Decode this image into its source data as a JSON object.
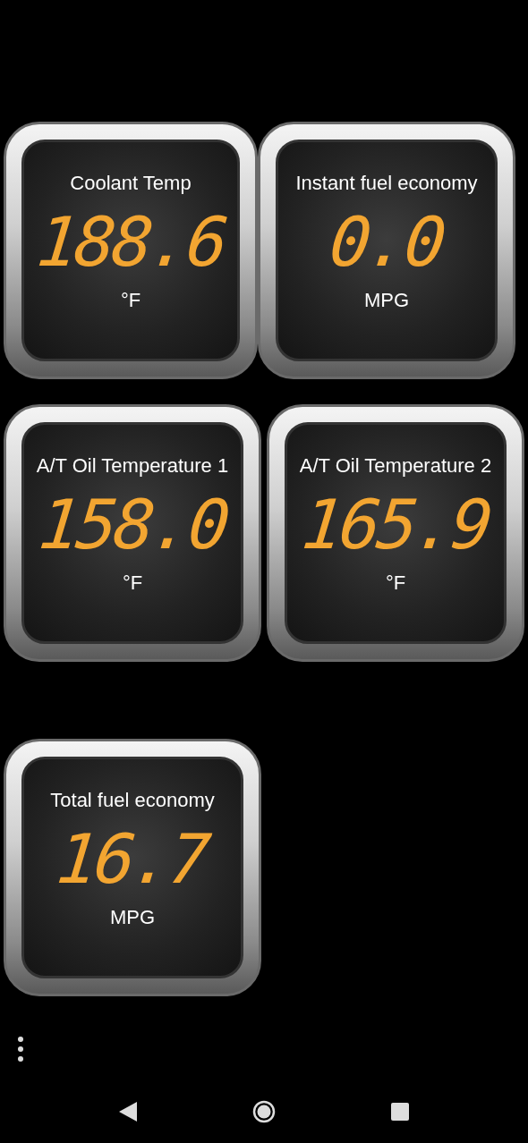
{
  "dashboard": {
    "rows": [
      [
        {
          "label": "Coolant Temp",
          "value": "188.6",
          "unit": "°F"
        },
        {
          "label": "Instant fuel economy",
          "value": "0.0",
          "unit": "MPG"
        }
      ],
      [
        {
          "label": "A/T Oil Temperature 1",
          "value": "158.0",
          "unit": "°F"
        },
        {
          "label": "A/T Oil Temperature 2",
          "value": "165.9",
          "unit": "°F"
        }
      ],
      [
        {
          "label": "Total fuel economy",
          "value": "16.7",
          "unit": "MPG"
        }
      ]
    ]
  }
}
